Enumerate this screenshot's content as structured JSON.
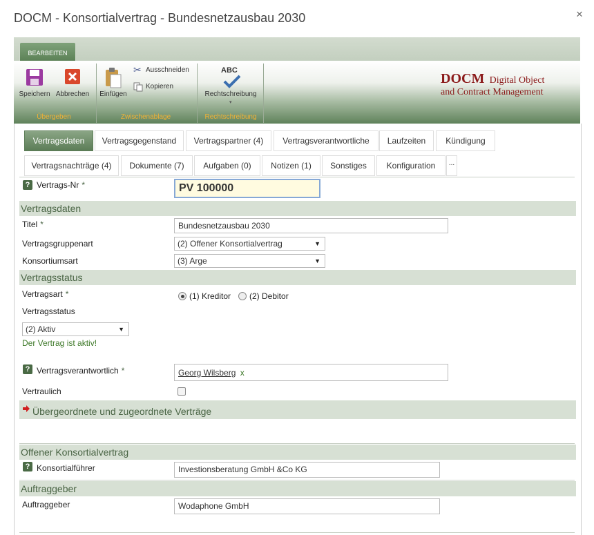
{
  "window": {
    "title": "DOCM - Konsortialvertrag - Bundesnetzausbau 2030",
    "close_glyph": "×"
  },
  "ribbon": {
    "tab_label": "BEARBEITEN",
    "groups": {
      "uebergeben": "Übergeben",
      "zwischenablage": "Zwischenablage",
      "rechtschreibung": "Rechtschreibung"
    },
    "buttons": {
      "speichern": "Speichern",
      "abbrechen": "Abbrechen",
      "einfuegen": "Einfügen",
      "ausschneiden": "Ausschneiden",
      "kopieren": "Kopieren",
      "rechtschreibung": "Rechtschreibung",
      "abc": "ABC"
    },
    "logo": {
      "main": "DOCM",
      "line1": "Digital Object",
      "line2": "and Contract Management",
      "color": "#8b1a1a"
    }
  },
  "tabs_row1": [
    "Vertragsdaten",
    "Vertragsgegenstand",
    "Vertragspartner (4)",
    "Vertragsverantwortliche",
    "Laufzeiten",
    "Kündigung"
  ],
  "tabs_row2": [
    "Vertragsnachträge (4)",
    "Dokumente (7)",
    "Aufgaben (0)",
    "Notizen (1)",
    "Sonstiges",
    "Konfiguration",
    "..."
  ],
  "form": {
    "vertrags_nr": {
      "label": "Vertrags-Nr",
      "value": "PV 100000"
    },
    "sections": {
      "vertragsdaten": "Vertragsdaten",
      "vertragsstatus": "Vertragsstatus",
      "uebergeordnete": "Übergeordnete und zugeordnete Verträge",
      "offener": "Offener Konsortialvertrag",
      "auftraggeber": "Auftraggeber"
    },
    "titel": {
      "label": "Titel",
      "value": "Bundesnetzausbau 2030"
    },
    "vertragsgruppenart": {
      "label": "Vertragsgruppenart",
      "value": "(2) Offener Konsortialvertrag"
    },
    "konsortiumsart": {
      "label": "Konsortiumsart",
      "value": "(3) Arge"
    },
    "vertragsart": {
      "label": "Vertragsart",
      "option1": "(1) Kreditor",
      "option2": "(2) Debitor"
    },
    "vertragsstatus": {
      "label": "Vertragsstatus",
      "value": "(2) Aktiv",
      "message": "Der Vertrag ist aktiv!"
    },
    "vertragsverantwortlich": {
      "label": "Vertragsverantwortlich",
      "value": "Georg Wilsberg",
      "remove": "x"
    },
    "vertraulich": {
      "label": "Vertraulich"
    },
    "konsortialfuehrer": {
      "label": "Konsortialführer",
      "value": "Investionsberatung GmbH &Co KG"
    },
    "auftraggeber": {
      "label": "Auftraggeber",
      "value": "Wodaphone GmbH"
    },
    "required_mark": "*",
    "help_mark": "?"
  }
}
